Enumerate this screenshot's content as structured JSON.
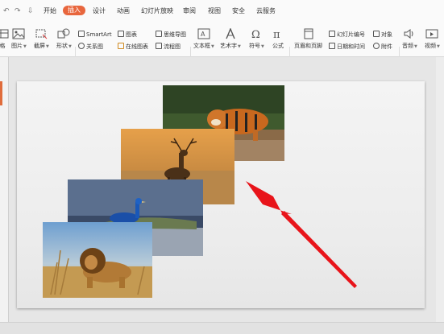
{
  "quick_access": {
    "undo_icon": "↶",
    "redo_icon": "↷",
    "customize_icon": "⇩"
  },
  "menu": {
    "items": [
      {
        "label": "开始"
      },
      {
        "label": "插入",
        "active": true
      },
      {
        "label": "设计"
      },
      {
        "label": "动画"
      },
      {
        "label": "幻灯片放映"
      },
      {
        "label": "审阅"
      },
      {
        "label": "视图"
      },
      {
        "label": "安全"
      },
      {
        "label": "云服务"
      }
    ],
    "active_color": "#e8663d"
  },
  "ribbon": {
    "partial_left_label": "格",
    "picture": "图片",
    "screenshot": "截屏",
    "shape": "形状",
    "smartart": "SmartArt",
    "chart": "图表",
    "relation_chart": "关系图",
    "online_chart": "在线图表",
    "mindmap": "思维导图",
    "flowchart": "流程图",
    "textbox": "文本框",
    "wordart": "艺术字",
    "symbol": "符号",
    "formula": "公式",
    "header_footer": "页眉和页脚",
    "slide_number": "幻灯片编号",
    "object": "对象",
    "datetime": "日期和时间",
    "attachment": "附件",
    "audio": "音频",
    "video": "视频"
  },
  "slide": {
    "photos": [
      "tiger-photo",
      "deer-photo",
      "peacock-photo",
      "lion-photo"
    ],
    "arrow_color": "#e8141a"
  }
}
